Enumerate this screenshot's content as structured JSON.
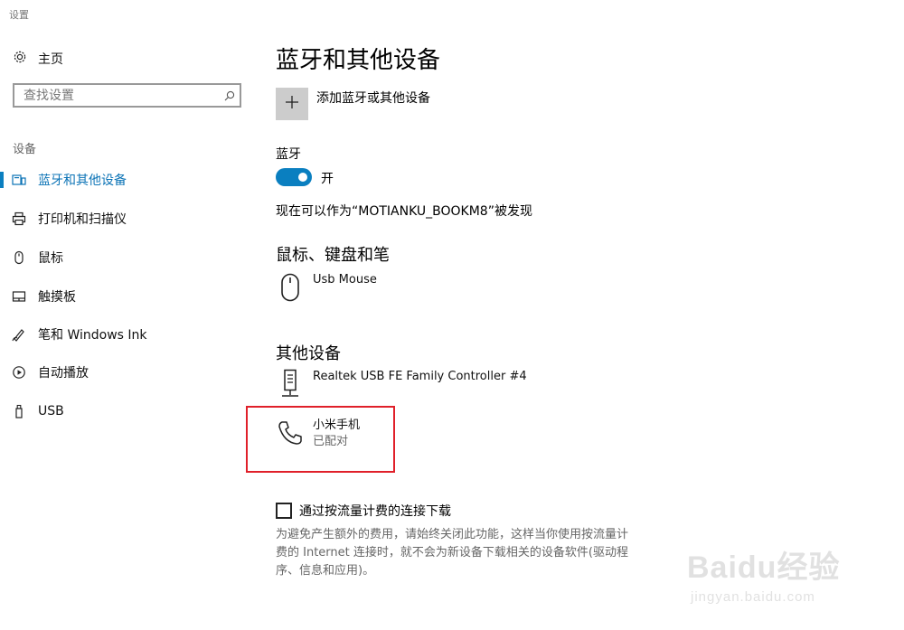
{
  "window": {
    "title": "设置"
  },
  "sidebar": {
    "home_label": "主页",
    "search_placeholder": "查找设置",
    "section_label": "设备",
    "items": [
      {
        "label": "蓝牙和其他设备",
        "icon": "bluetooth-devices-icon",
        "active": true
      },
      {
        "label": "打印机和扫描仪",
        "icon": "printer-icon",
        "active": false
      },
      {
        "label": "鼠标",
        "icon": "mouse-icon",
        "active": false
      },
      {
        "label": "触摸板",
        "icon": "touchpad-icon",
        "active": false
      },
      {
        "label": "笔和 Windows Ink",
        "icon": "pen-icon",
        "active": false
      },
      {
        "label": "自动播放",
        "icon": "autoplay-icon",
        "active": false
      },
      {
        "label": "USB",
        "icon": "usb-icon",
        "active": false
      }
    ]
  },
  "main": {
    "title": "蓝牙和其他设备",
    "add_device_label": "添加蓝牙或其他设备",
    "bluetooth_label": "蓝牙",
    "bluetooth_state": "开",
    "bluetooth_on": true,
    "discoverable_text": "现在可以作为“MOTIANKU_BOOKM8”被发现",
    "sections": [
      {
        "heading": "鼠标、键盘和笔",
        "devices": [
          {
            "name": "Usb Mouse",
            "status": "",
            "icon": "mouse-icon"
          }
        ]
      },
      {
        "heading": "其他设备",
        "devices": [
          {
            "name": "Realtek USB FE Family Controller #4",
            "status": "",
            "icon": "network-adapter-icon"
          },
          {
            "name": "小米手机",
            "status": "已配对",
            "icon": "phone-icon"
          }
        ]
      }
    ],
    "metered_download_label": "通过按流量计费的连接下载",
    "metered_download_checked": false,
    "metered_help": "为避免产生额外的费用，请始终关闭此功能，这样当你使用按流量计费的 Internet 连接时，就不会为新设备下载相关的设备软件(驱动程序、信息和应用)。"
  },
  "watermark": {
    "logo": "Baidu经验",
    "url": "jingyan.baidu.com"
  },
  "colors": {
    "accent": "#0a7fc0",
    "highlight": "#e0202a"
  }
}
